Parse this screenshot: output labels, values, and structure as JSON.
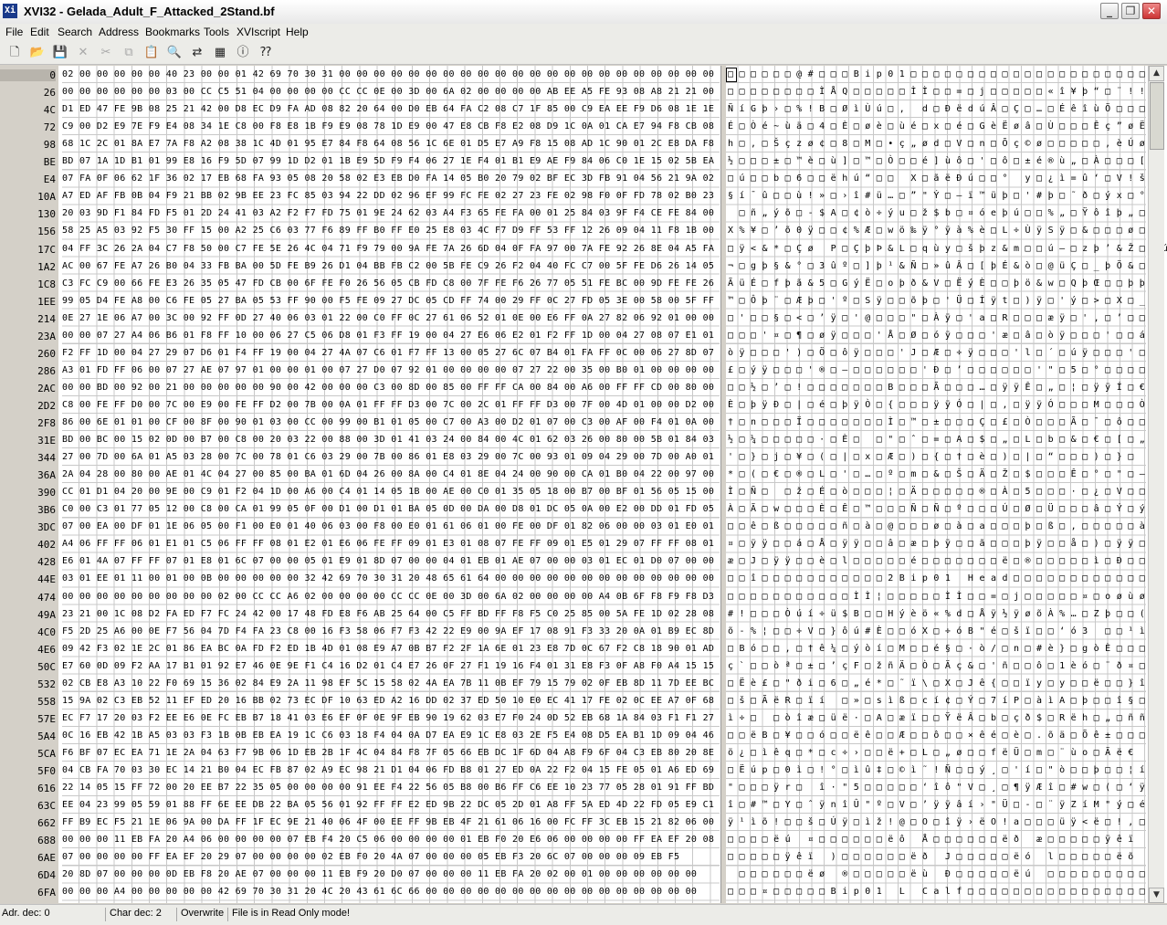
{
  "window": {
    "title": "XVI32 - Gelada_Adult_F_Attacked_2Stand.bf",
    "icon": "hex-editor-app-icon",
    "controls": [
      "minimize-icon",
      "maximize-icon",
      "close-icon"
    ]
  },
  "menu": [
    "File",
    "Edit",
    "Search",
    "Address",
    "Bookmarks",
    "Tools",
    "XVIscript",
    "Help"
  ],
  "toolbar": {
    "buttons": [
      "new-file-icon",
      "open-folder-icon",
      "save-icon",
      "close-file-icon",
      "cut-icon",
      "copy-icon",
      "paste-icon",
      "find-icon",
      "replace-icon",
      "properties-icon",
      "script-icon",
      "context-help-icon"
    ]
  },
  "editor": {
    "addresses": [
      "0",
      "26",
      "4C",
      "72",
      "98",
      "BE",
      "E4",
      "10A",
      "130",
      "156",
      "17C",
      "1A2",
      "1C8",
      "1EE",
      "214",
      "23A",
      "260",
      "286",
      "2AC",
      "2D2",
      "2F8",
      "31E",
      "344",
      "36A",
      "390",
      "3B6",
      "3DC",
      "402",
      "428",
      "44E",
      "474",
      "49A",
      "4C0",
      "4E6",
      "50C",
      "532",
      "558",
      "57E",
      "5A4",
      "5CA",
      "5F0",
      "616",
      "63C",
      "662",
      "688",
      "6AE",
      "6D4",
      "6FA"
    ],
    "hex_rows": [
      "02 00 00 00 00 00 40 23 00 00 01 42 69 70 30 31 00 00 00 00 00 00 00 00 00 00 00 00 00 00 00 00 00 00 00 00 00 00",
      "00 00 00 00 00 00 03 00 CC C5 51 04 00 00 00 00 CC CC 0E 00 3D 00 6A 02 00 00 00 00 AB EE A5 FE 93 08 A8 21 21 00",
      "D1 ED 47 FE 9B 08 25 21 42 00 D8 EC D9 FA AD 08 82 20 64 00 D0 EB 64 FA C2 08 C7 1F 85 00 C9 EA EE F9 D6 08 1E 1E",
      "C9 00 D2 E9 7E F9 E4 08 34 1E C8 00 F8 E8 1B F9 E9 08 78 1D E9 00 47 E8 CB F8 E2 08 D9 1C 0A 01 CA E7 94 F8 CB 08",
      "68 1C 2C 01 8A E7 7A F8 A2 08 38 1C 4D 01 95 E7 84 F8 64 08 56 1C 6E 01 D5 E7 A9 F8 15 08 AD 1C 90 01 2C E8 DA F8",
      "BD 07 1A 1D B1 01 99 E8 16 F9 5D 07 99 1D D2 01 1B E9 5D F9 F4 06 27 1E F4 01 B1 E9 AE F9 84 06 C0 1E 15 02 5B EA",
      "07 FA 0F 06 62 1F 36 02 17 EB 68 FA 93 05 08 20 58 02 E3 EB D0 FA 14 05 B0 20 79 02 BF EC 3D FB 91 04 56 21 9A 02",
      "A7 ED AF FB 0B 04 F9 21 BB 02 9B EE 23 FC 85 03 94 22 DD 02 96 EF 99 FC FE 02 27 23 FE 02 98 F0 0F FD 78 02 B0 23",
      "20 03 9D F1 84 FD F5 01 2D 24 41 03 A2 F2 F7 FD 75 01 9E 24 62 03 A4 F3 65 FE FA 00 01 25 84 03 9F F4 CE FE 84 00",
      "58 25 A5 03 92 F5 30 FF 15 00 A2 25 C6 03 77 F6 89 FF B0 FF E0 25 E8 03 4C F7 D9 FF 53 FF 12 26 09 04 11 F8 1B 00",
      "04 FF 3C 26 2A 04 C7 F8 50 00 C7 FE 5E 26 4C 04 71 F9 79 00 9A FE 7A 26 6D 04 0F FA 97 00 7A FE 92 26 8E 04 A5 FA",
      "AC 00 67 FE A7 26 B0 04 33 FB BA 00 5D FE B9 26 D1 04 BB FB C2 00 5B FE C9 26 F2 04 40 FC C7 00 5F FE D6 26 14 05",
      "C3 FC C9 00 66 FE E3 26 35 05 47 FD CB 00 6F FE F0 26 56 05 CB FD C8 00 7F FE F6 26 77 05 51 FE BC 00 9D FE FE 26",
      "99 05 D4 FE A8 00 C6 FE 05 27 BA 05 53 FF 90 00 F5 FE 09 27 DC 05 CD FF 74 00 29 FF 0C 27 FD 05 3E 00 58 00 5F FF",
      "0E 27 1E 06 A7 00 3C 00 92 FF 0D 27 40 06 03 01 22 00 C0 FF 0C 27 61 06 52 01 0E 00 E6 FF 0A 27 82 06 92 01 00 00",
      "00 00 07 27 A4 06 B6 01 F8 FF 10 00 06 27 C5 06 D8 01 F3 FF 19 00 04 27 E6 06 E2 01 F2 FF 1D 00 04 27 08 07 E1 01",
      "F2 FF 1D 00 04 27 29 07 D6 01 F4 FF 19 00 04 27 4A 07 C6 01 F7 FF 13 00 05 27 6C 07 B4 01 FA FF 0C 00 06 27 8D 07",
      "A3 01 FD FF 06 00 07 27 AE 07 97 01 00 00 01 00 07 27 D0 07 92 01 00 00 00 00 07 27 22 00 35 00 B0 01 00 00 00 00",
      "00 00 BD 00 92 00 21 00 00 00 00 00 90 00 42 00 00 00 C3 00 8D 00 85 00 FF FF CA 00 84 00 A6 00 FF FF CD 00 80 00",
      "C8 00 FE FF D0 00 7C 00 E9 00 FE FF D2 00 7B 00 0A 01 FF FF D3 00 7C 00 2C 01 FF FF D3 00 7F 00 4D 01 00 00 D2 00",
      "86 00 6E 01 01 00 CF 00 8F 00 90 01 03 00 CC 00 99 00 B1 01 05 00 C7 00 A3 00 D2 01 07 00 C3 00 AF 00 F4 01 0A 00",
      "BD 00 BC 00 15 02 0D 00 B7 00 C8 00 20 03 22 00 88 00 3D 01 41 03 24 00 84 00 4C 01 62 03 26 00 80 00 5B 01 84 03",
      "27 00 7D 00 6A 01 A5 03 28 00 7C 00 78 01 C6 03 29 00 7B 00 86 01 E8 03 29 00 7C 00 93 01 09 04 29 00 7D 00 A0 01",
      "2A 04 28 00 80 00 AE 01 4C 04 27 00 85 00 BA 01 6D 04 26 00 8A 00 C4 01 8E 04 24 00 90 00 CA 01 B0 04 22 00 97 00",
      "CC 01 D1 04 20 00 9E 00 C9 01 F2 04 1D 00 A6 00 C4 01 14 05 1B 00 AE 00 C0 01 35 05 18 00 B7 00 BF 01 56 05 15 00",
      "C0 00 C3 01 77 05 12 00 C8 00 CA 01 99 05 0F 00 D1 00 D1 01 BA 05 0D 00 DA 00 D8 01 DC 05 0A 00 E2 00 DD 01 FD 05",
      "07 00 EA 00 DF 01 1E 06 05 00 F1 00 E0 01 40 06 03 00 F8 00 E0 01 61 06 01 00 FE 00 DF 01 82 06 00 00 03 01 E0 01",
      "A4 06 FF FF 06 01 E1 01 C5 06 FF FF 08 01 E2 01 E6 06 FE FF 09 01 E3 01 08 07 FE FF 09 01 E5 01 29 07 FF FF 08 01",
      "E6 01 4A 07 FF FF 07 01 E8 01 6C 07 00 00 05 01 E9 01 8D 07 00 00 04 01 EB 01 AE 07 00 00 03 01 EC 01 D0 07 00 00",
      "03 01 EE 01 11 00 01 00 0B 00 00 00 00 00 32 42 69 70 30 31 20 48 65 61 64 00 00 00 00 00 00 00 00 00 00 00 00 00",
      "00 00 00 00 00 00 00 00 00 02 00 CC CC A6 02 00 00 00 00 CC CC 0E 00 3D 00 6A 02 00 00 00 00 A4 0B 6F F8 F9 F8 D3",
      "23 21 00 1C 08 D2 FA ED F7 FC 24 42 00 17 48 FD E8 F6 AB 25 64 00 C5 FF BD FF F8 F5 C0 25 85 00 5A FE 1D 02 28 08",
      "F5 2D 25 A6 00 0E F7 56 04 7D F4 FA 23 C8 00 16 F3 58 06 F7 F3 42 22 E9 00 9A EF 17 08 91 F3 33 20 0A 01 B9 EC 8D",
      "09 42 F3 02 1E 2C 01 86 EA BC 0A FD F2 ED 1B 4D 01 08 E9 A7 0B B7 F2 2F 1A 6E 01 23 E8 7D 0C 67 F2 C8 18 90 01 AD",
      "E7 60 0D 09 F2 AA 17 B1 01 92 E7 46 0E 9E F1 C4 16 D2 01 C4 E7 26 0F 27 F1 19 16 F4 01 31 E8 F3 0F A8 F0 A4 15 15",
      "02 CB E8 A3 10 22 F0 69 15 36 02 84 E9 2A 11 98 EF 5C 15 58 02 4A EA 7B 11 0B EF 79 15 79 02 0F EB 8D 11 7D EE BC",
      "15 9A 02 C3 EB 52 11 EF ED 20 16 BB 02 73 EC DF 10 63 ED A2 16 DD 02 37 ED 50 10 E0 EC 41 17 FE 02 0C EE A7 0F 68",
      "EC F7 17 20 03 F2 EE E6 0E FC EB B7 18 41 03 E6 EF 0F 0E 9F EB 90 19 62 03 E7 F0 24 0D 52 EB 68 1A 84 03 F1 F1 27",
      "0C 16 EB 42 1B A5 03 03 F3 1B 0B EB EA 19 1C C6 03 18 F4 04 0A D7 EA E9 1C E8 03 2E F5 E4 08 D5 EA B1 1D 09 04 46",
      "F6 BF 07 EC EA 71 1E 2A 04 63 F7 9B 06 1D EB 2B 1F 4C 04 84 F8 7F 05 66 EB DC 1F 6D 04 A8 F9 6F 04 C3 EB 80 20 8E",
      "04 CB FA 70 03 30 EC 14 21 B0 04 EC FB 87 02 A9 EC 98 21 D1 04 06 FD B8 01 27 ED 0A 22 F2 04 15 FE 05 01 A6 ED 69",
      "22 14 05 15 FF 72 00 20 EE B7 22 35 05 00 00 00 00 91 EE F4 22 56 05 B8 00 B6 FF C6 EE 10 23 77 05 28 01 91 FF BD",
      "EE 04 23 99 05 59 01 88 FF 6E EE DB 22 BA 05 56 01 92 FF FF E2 ED 9B 22 DC 05 2D 01 A8 FF 5A ED 4D 22 FD 05 E9 C1",
      "FF B9 EC F5 21 1E 06 9A 00 DA FF 1F EC 9E 21 40 06 4F 00 EE FF 9B EB 4F 21 61 06 16 00 FC FF 3C EB 15 21 82 06 00",
      "00 00 00 11 EB FA 20 A4 06 00 00 00 00 07 EB F4 20 C5 06 00 00 00 00 01 EB F0 20 E6 06 00 00 00 00 FF EA EF 20 08",
      "07 00 00 00 00 FF EA EF 20 29 07 00 00 00 00 02 EB F0 20 4A 07 00 00 00 05 EB F3 20 6C 07 00 00 00 09 EB F5",
      "20 8D 07 00 00 00 0D EB F8 20 AE 07 00 00 00 11 EB F9 20 D0 07 00 00 00 11 EB FA 20 02 00 01 00 00 00 00 00 00",
      "00 00 00 A4 00 00 00 00 00 42 69 70 30 31 20 4C 20 43 61 6C 66 00 00 00 00 00 00 00 00 00 00 00 00 00 00 00 00"
    ],
    "char_rows": [
      "□□□□□□@#□□□Bip01□□□□□□□□□□□□□□□□□□□□□□",
      "□□□□□□□□ÌÅQ□□□□□ÌÌ□□=□j□□□□□«î¥þ“□¨!!□",
      "ÑíGþ›□%!B□ØìÙú­□‚ d□ÐëdúÂ□Ç□…□ÉêîùÖ□□□",
      "É□Òé~ùä□4□È□øè□ùé□x□é□GèËøâ□Ù□□□Êç”øË□",
      "h□,□Šçzø¢□8□M□•ç„ød□V□n□Õç©ø□□­□□□,èÚø",
      "½□□□±□™è□ù]□™□Ò□□é]ùô□'□ô□±é®ù„□À□□□[ê",
      "□ú□□b□6□□ëhú“□□ X□ãëÐú□□° y□¿ì=û‘□V!š□",
      "§í¯û□□ù!»□›î#ü…□”\"Ý□–ï™üþ□'#þ□˜ð□ýx□°#",
      " □ñ„ýõ□-$A□¢ò÷ýu□ž$b□¤óeþú□□%„□Ÿôîþ„□",
      "X%¥□’õ0ÿ□□¢%Æ□wö‰ÿ°ÿà%è□L÷ÙÿSÿ□&□□□ø□□",
      "□ÿ<&*□Çø P□ÇþÞ&L□qùy□šþz&m□□ú—□zþ’&Ž□¥ú",
      "¬□gþ§&°□3ûº□]þ¹&Ñ□»ûÂ□[þÉ&ò□@üÇ□_þÖ&□□",
      "ÃüÉ□fþã&5□GýË□oþð&V□ËýÈ□□þö&w□QþŒ□□þþ&",
      "™□Ôþ¨□Æþ□'º□Sÿ□□õþ□'Ü□Íÿt□)ÿ□'ý□>□X□_ÿ",
      "□'□□§□<□’ÿ□'@□□□\"□Àÿ□'a□R□□□æÿ□'‚□’□□□",
      "□□□'¤□¶□øÿ□□□'Å□Ø□óÿ□□□'æ□â□òÿ□□□'□□á□",
      "òÿ□□□')□Ö□ôÿ□□□'J□Æ□÷ÿ□□□'l□´□úÿ□□□'□□",
      "£□ýÿ□□□'®□—□□□□□□'Ð□’□□□□□□'\"□5□°□□□□□",
      "□□½□’□!□□□□□□□B□□□Ã□□□…□ÿÿÊ□„□¦□ÿÿÍ□€□",
      "È□þÿÐ□|□é□þÿÒ□{□□□ÿÿÓ□|□,□ÿÿÓ□□□M□□□Ò□",
      "†□n□□□Ï□□□□□□□Ì□™□±□□□Ç□£□Ò□□□Ã□¯□ô□□□",
      "½□¼□□□□□·□È□ □\"□ˆ□=□A□$□„□L□b□&□€□[□„□",
      "'□}□j□¥□(□|□x□Æ□)□{□†□è□)□|□“□□□)□}□ □",
      "*□(□€□®□L□'□…□º□m□&□Š□Ä□Ž□$□□□Ê□°□\"□—□",
      "Ì□Ñ□ □ž□É□ò□□□¦□Ä□□□□□®□À□5□□□·□¿□V□□□",
      "À□Ã□w□□□È□Ê□™□□□Ñ□Ñ□º□□□Ú□Ø□Ü□□□â□Ý□ý□",
      "□□ê□ß□□□□□ñ□à□@□□□ø□à□a□□□þ□ß□‚□□□□□à□",
      "¤□ÿÿ□□á□Å□ÿÿ□□â□æ□þÿ□□ã□□□þÿ□□å□)□ÿÿ□□",
      "æ□J□ÿÿ□□è□l□□□□□é□□□□□□□ë□®□□□□□ì□Ð□□□",
      "□□î□□□□□□□□□□□2Bip01 Head□□□□□□□□□□□□□",
      "□□□□□□□□□□□ÌÌ¦□□□□□ÌÌ□□=□j□□□□□¤□oøùøÓ",
      "#!□□□Òúí÷ü$B□□Hýèö«%d□Åÿ½ÿøõÀ%…□Zþ□□(□",
      "õ-%¦□□÷V□}ôú#È□□óX□÷óB\"é□šï□□‘ó3 □□¹ì□",
      "□Bó□□,□†ê¼□ýòí□M□□é§□·ò/□n□#è}□gòÈ□□□­",
      "ç`□□òª□±□’çF□žñÄ□Ò□Äç&□'ñ□□ô□1èó□¨ð¤□□",
      "□Ëè£□\"ði□6□„é*□˜ï\\□X□Jê{□□ïy□y□□ë□□}î¼",
      "□š□ÃëR□ïí □»□sìß□cí¢□Ý□7íP□àìA□þ□□î§□h",
      "ì÷□ □òîæ□üë·□A□æï□□ŸëÂ□b□çð$□Rëh□„□ññ'",
      "□□ëB□¥□□ó□□ëê□□Æ□□ô□□×êé□è□.õä□Õê±□□□F",
      "ö¿□ìêq□*□c÷›□□ë+□L□„ø□□fëÜ□m□¨ùo□Ãë€ Ž",
      "□Ëúp□0ì□!°□ìû‡□©ì˜!Ñ□□ý¸□'í□\"ò□□þ□□¦íi",
      "\"□□□ÿr□ î·\"5□□□□□‘îô\"V□¸□¶ÿÆî□#w□(□‘ÿ½",
      "î□#™□Y□ˆÿnîÛ\"º□V□’ÿÿâí›\"Ü□-□¨ÿZíM\"ý□éÁ",
      "ÿ¹ìõ!□□š□Úÿ□ìž!@□O□îÿ›ëO!a□□□üÿ<ë□!‚□□",
      "□□□□ëú ¤□□□□□□ëô Å□□□□□□ëð æ□□□□□ÿêï □",
      "□□□□□ÿêï )□□□□□□ëð J□□□□□ëó l□□□□□ëõ",
      " □□□□□□ëø ®□□□□□ëù Ð□□□□□ëú □□□□□□□□□",
      "□□□¤□□□□□Bip01 L Calf□□□□□□□□□□□□□□□□"
    ]
  },
  "status": {
    "address": "Adr. dec: 0",
    "char": "Char dec: 2",
    "mode": "Overwrite",
    "message": "File is in Read Only mode!"
  }
}
